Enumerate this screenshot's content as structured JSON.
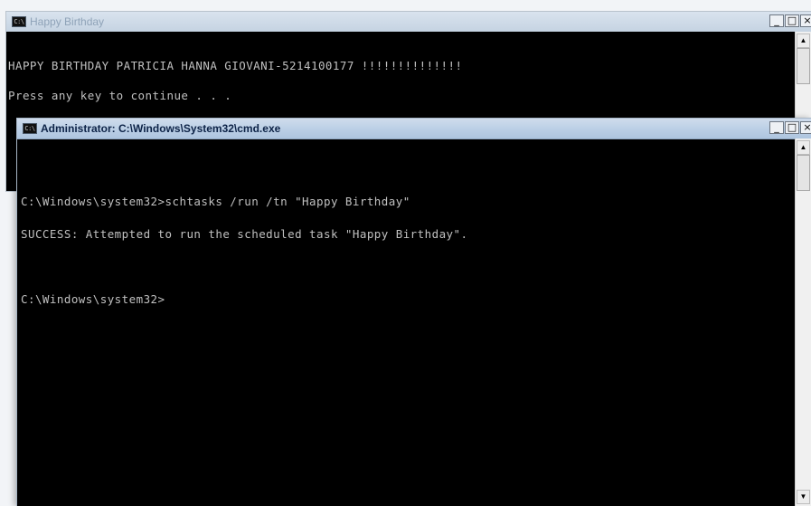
{
  "back_window": {
    "title": "Happy Birthday",
    "icon": "console-icon",
    "controls": [
      "minimize-icon",
      "maximize-icon",
      "close-icon"
    ],
    "output": [
      "HAPPY BIRTHDAY PATRICIA HANNA GIOVANI-5214100177 !!!!!!!!!!!!!!",
      "Press any key to continue . . ."
    ]
  },
  "front_window": {
    "title": "Administrator: C:\\Windows\\System32\\cmd.exe",
    "icon": "console-icon",
    "controls": [
      "minimize-icon",
      "maximize-icon",
      "close-icon"
    ],
    "output": [
      "",
      "C:\\Windows\\system32>schtasks /run /tn \"Happy Birthday\"",
      "SUCCESS: Attempted to run the scheduled task \"Happy Birthday\".",
      "",
      "C:\\Windows\\system32>"
    ]
  },
  "colors": {
    "console_bg": "#000000",
    "console_text": "#c0c0c0",
    "title_active": "#0d2347",
    "title_inactive": "#8fa3b8"
  }
}
